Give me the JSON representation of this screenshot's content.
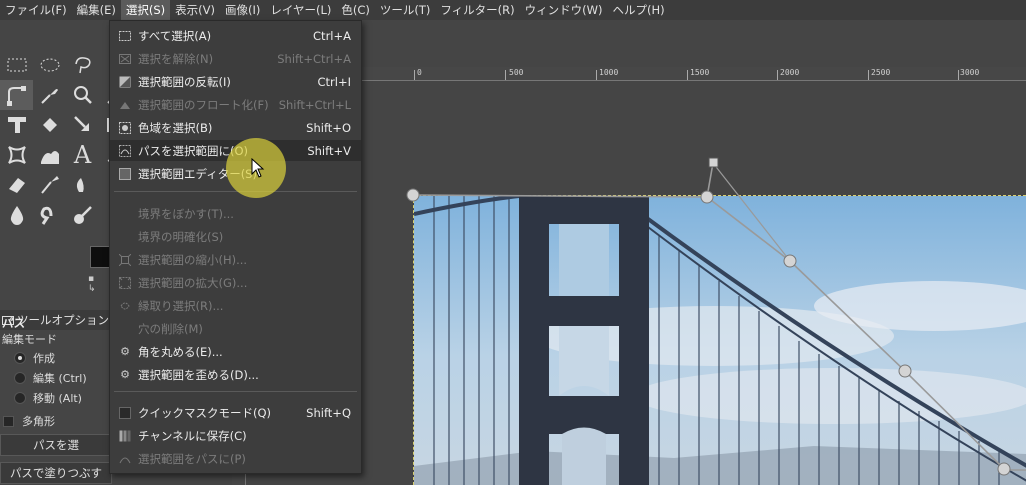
{
  "menubar": {
    "items": [
      "ファイル(F)",
      "編集(E)",
      "選択(S)",
      "表示(V)",
      "画像(I)",
      "レイヤー(L)",
      "色(C)",
      "ツール(T)",
      "フィルター(R)",
      "ウィンドウ(W)",
      "ヘルプ(H)"
    ],
    "active_index": 2
  },
  "select_menu": {
    "items": [
      {
        "label": "すべて選択(A)",
        "shortcut": "Ctrl+A",
        "enabled": true,
        "icon": "select-all-icon"
      },
      {
        "label": "選択を解除(N)",
        "shortcut": "Shift+Ctrl+A",
        "enabled": false,
        "icon": "select-none-icon"
      },
      {
        "label": "選択範囲の反転(I)",
        "shortcut": "Ctrl+I",
        "enabled": true,
        "icon": "invert-icon"
      },
      {
        "label": "選択範囲のフロート化(F)",
        "shortcut": "Shift+Ctrl+L",
        "enabled": false,
        "icon": "float-icon"
      },
      {
        "label": "色域を選択(B)",
        "shortcut": "Shift+O",
        "enabled": true,
        "icon": "color-select-icon"
      },
      {
        "label": "パスを選択範囲に(O)",
        "shortcut": "Shift+V",
        "enabled": true,
        "icon": "path-to-selection-icon",
        "highlighted": true
      },
      {
        "label": "選択範囲エディター(S)",
        "shortcut": "",
        "enabled": true,
        "icon": "selection-editor-icon"
      },
      {
        "label": "境界をぼかす(T)...",
        "shortcut": "",
        "enabled": false,
        "icon": ""
      },
      {
        "label": "境界の明確化(S)",
        "shortcut": "",
        "enabled": false,
        "icon": ""
      },
      {
        "label": "選択範囲の縮小(H)...",
        "shortcut": "",
        "enabled": false,
        "icon": "shrink-icon"
      },
      {
        "label": "選択範囲の拡大(G)...",
        "shortcut": "",
        "enabled": false,
        "icon": "grow-icon"
      },
      {
        "label": "縁取り選択(R)...",
        "shortcut": "",
        "enabled": false,
        "icon": "border-icon"
      },
      {
        "label": "穴の削除(M)",
        "shortcut": "",
        "enabled": false,
        "icon": ""
      },
      {
        "label": "角を丸める(E)...",
        "shortcut": "",
        "enabled": true,
        "icon": "gear-icon"
      },
      {
        "label": "選択範囲を歪める(D)...",
        "shortcut": "",
        "enabled": true,
        "icon": "gear-icon"
      },
      {
        "label": "クイックマスクモード(Q)",
        "shortcut": "Shift+Q",
        "enabled": true,
        "icon": "checkbox-icon"
      },
      {
        "label": "チャンネルに保存(C)",
        "shortcut": "",
        "enabled": true,
        "icon": "channel-icon"
      },
      {
        "label": "選択範囲をパスに(P)",
        "shortcut": "",
        "enabled": false,
        "icon": "selection-to-path-icon"
      }
    ]
  },
  "tool_options": {
    "tab_label": "ツールオプション",
    "title": "パス",
    "mode_label": "編集モード",
    "modes": [
      "作成",
      "編集 (Ctrl)",
      "移動 (Alt)"
    ],
    "selected_mode": 0,
    "polygon_label": "多角形",
    "button1": "パスを選",
    "button2": "パスで塗りつぶす"
  },
  "ruler": {
    "labels": [
      "0",
      "500",
      "1000",
      "1500",
      "2000",
      "2500",
      "3000"
    ]
  },
  "colors": {
    "menu_bg": "#3d3d3d",
    "highlight": "#2e2e2e",
    "accent_yellow": "#dcd23c"
  }
}
